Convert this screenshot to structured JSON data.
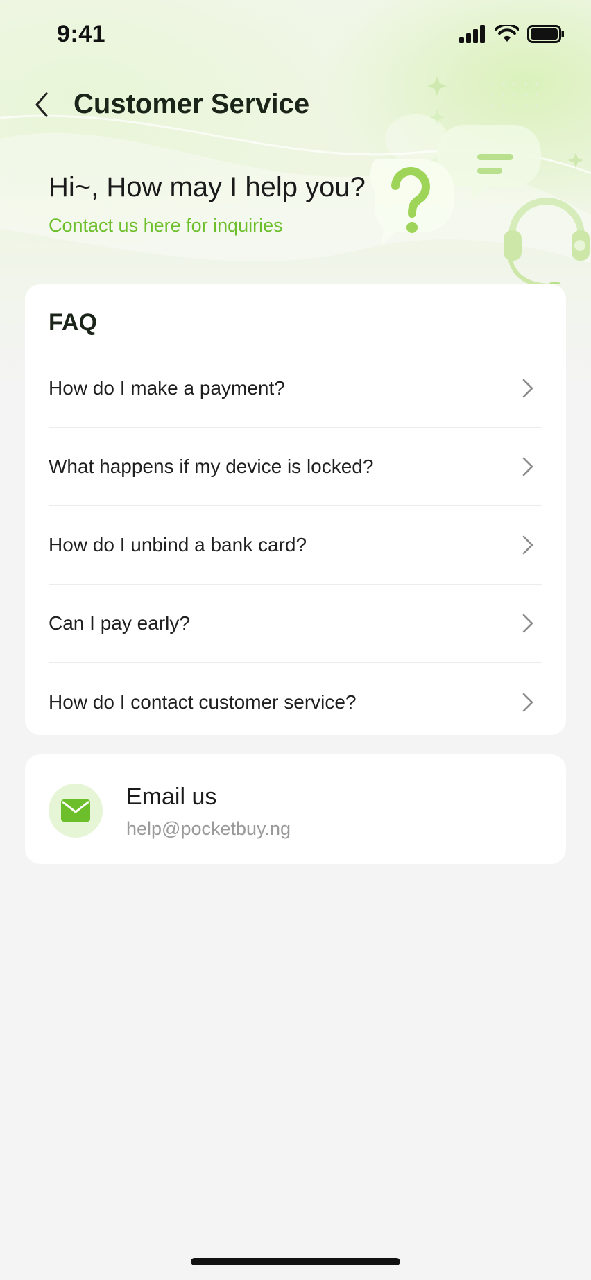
{
  "status_bar": {
    "time": "9:41",
    "icons": [
      "signal-icon",
      "wifi-icon",
      "battery-icon"
    ]
  },
  "nav": {
    "title": "Customer Service",
    "back_icon": "chevron-left-icon"
  },
  "hero": {
    "greeting": "Hi~, How may I help you?",
    "subtitle": "Contact us here for inquiries",
    "illustration": "customer-support-illustration"
  },
  "faq": {
    "title": "FAQ",
    "items": [
      {
        "label": "How do I make a payment?"
      },
      {
        "label": "What happens if my device is locked?"
      },
      {
        "label": "How do I unbind a bank card?"
      },
      {
        "label": "Can I pay early?"
      },
      {
        "label": "How do I contact customer service?"
      }
    ]
  },
  "email": {
    "label": "Email us",
    "address": "help@pocketbuy.ng",
    "icon": "mail-icon"
  },
  "colors": {
    "accent": "#6cbf2a",
    "background": "#f4f4f4",
    "card": "#ffffff",
    "title": "#1b2418",
    "muted": "#9a9a9a"
  }
}
